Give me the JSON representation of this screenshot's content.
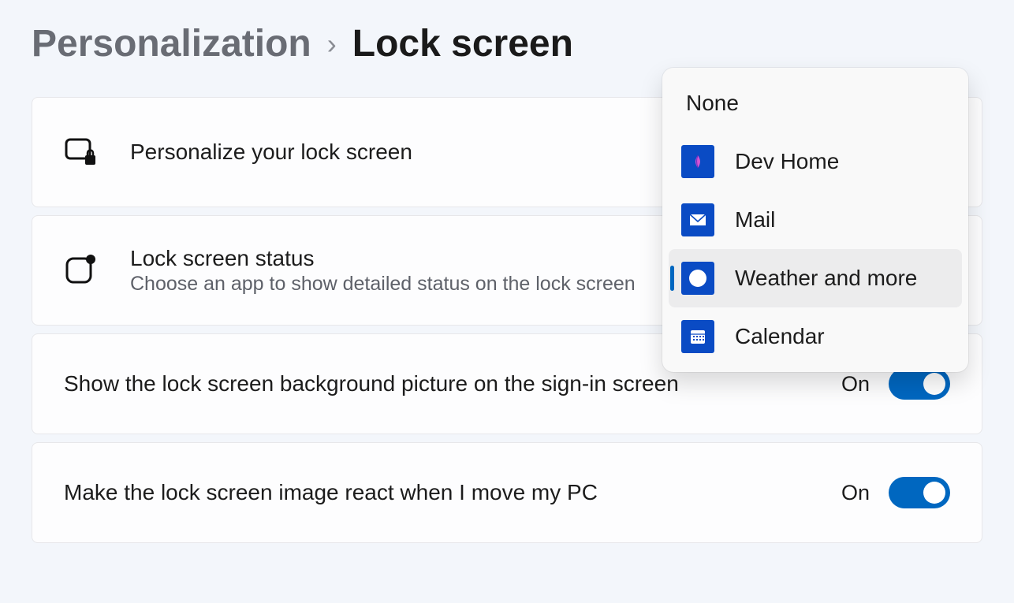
{
  "breadcrumb": {
    "parent": "Personalization",
    "current": "Lock screen"
  },
  "rows": {
    "personalize": {
      "title": "Personalize your lock screen"
    },
    "status": {
      "title": "Lock screen status",
      "subtitle": "Choose an app to show detailed status on the lock screen"
    },
    "show_bg": {
      "title": "Show the lock screen background picture on the sign-in screen",
      "state": "On"
    },
    "react": {
      "title": "Make the lock screen image react when I move my PC",
      "state": "On"
    }
  },
  "dropdown": {
    "none": "None",
    "items": [
      {
        "label": "Dev Home",
        "icon": "devhome",
        "selected": false
      },
      {
        "label": "Mail",
        "icon": "mail",
        "selected": false
      },
      {
        "label": "Weather and more",
        "icon": "weather",
        "selected": true
      },
      {
        "label": "Calendar",
        "icon": "calendar",
        "selected": false
      }
    ]
  }
}
